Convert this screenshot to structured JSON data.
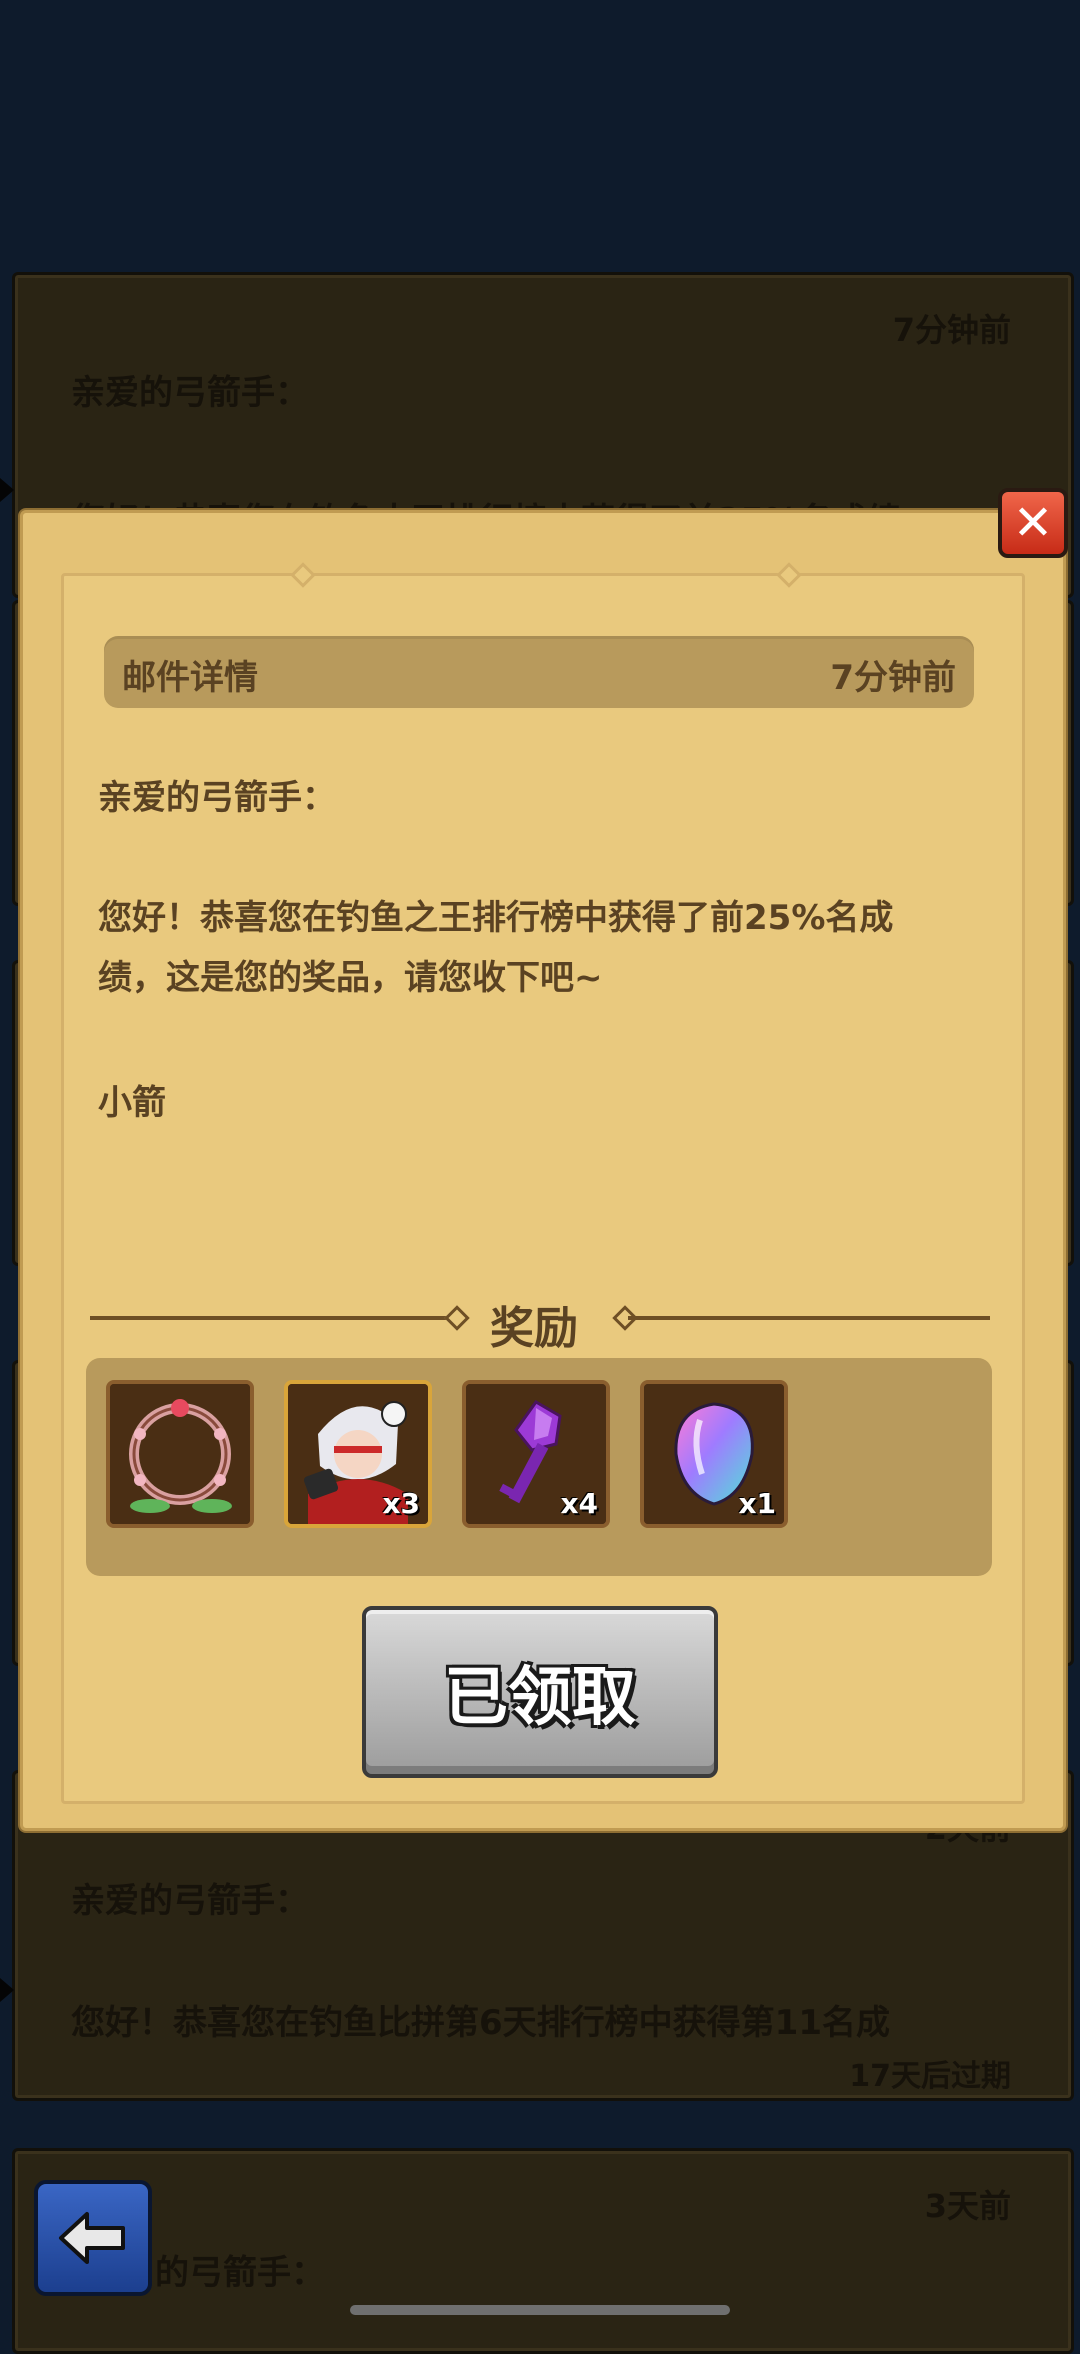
{
  "background": {
    "cards": [
      {
        "time": "7分钟前",
        "greeting": "亲爱的弓箭手：",
        "line": "您好！恭喜您在钓鱼大王排行榜中获得了前25%名成绩"
      },
      {
        "time": "2天前",
        "greeting": "亲爱的弓箭手：",
        "line": "您好！恭喜您在钓鱼比拼第6天排行榜中获得第11名成",
        "expire": "17天后过期"
      },
      {
        "time": "3天前",
        "greeting": "的弓箭手："
      }
    ]
  },
  "modal": {
    "header_title": "邮件详情",
    "header_time": "7分钟前",
    "greeting": "亲爱的弓箭手：",
    "body_line1": "您好！恭喜您在钓鱼之王排行榜中获得了前25%名成",
    "body_line2": "绩，这是您的奖品，请您收下吧~",
    "signature": "小箭",
    "rewards_title": "奖励",
    "rewards": [
      {
        "icon": "flower-wreath-frame-icon",
        "qty": ""
      },
      {
        "icon": "hero-portrait-icon",
        "qty": "x3"
      },
      {
        "icon": "purple-key-icon",
        "qty": "x4"
      },
      {
        "icon": "rainbow-gem-icon",
        "qty": "x1"
      }
    ],
    "claim_button": "已领取"
  },
  "colors": {
    "parchment": "#e4c276",
    "header_bar": "#b89a5c",
    "text_brown": "#5a4222",
    "close_red": "#d9412a",
    "back_blue": "#2a55b0"
  }
}
